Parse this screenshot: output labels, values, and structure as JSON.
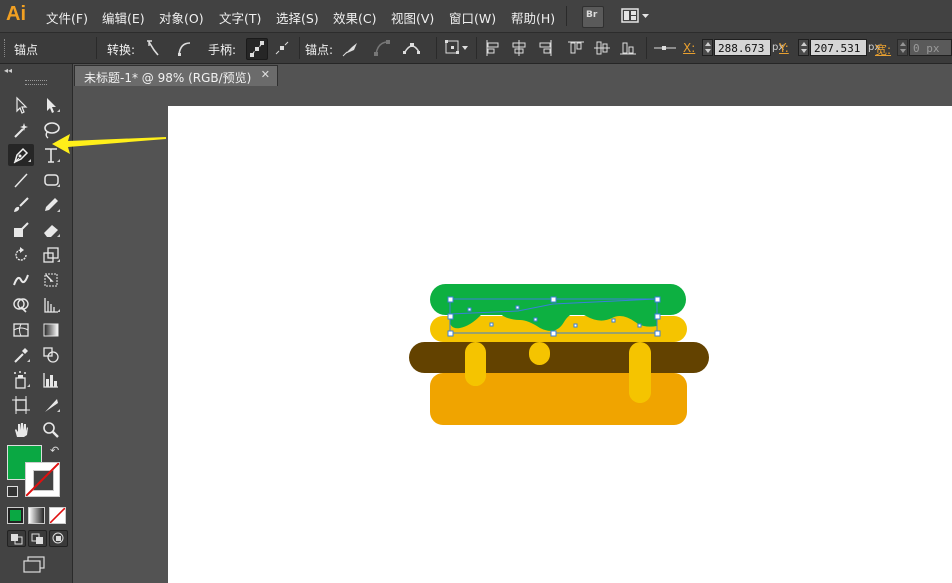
{
  "app": {
    "logo": "Ai"
  },
  "menu": [
    "文件(F)",
    "编辑(E)",
    "对象(O)",
    "文字(T)",
    "选择(S)",
    "效果(C)",
    "视图(V)",
    "窗口(W)",
    "帮助(H)"
  ],
  "menu_buttons": {
    "bridge": "Br"
  },
  "control_bar": {
    "anchor_label": "锚点",
    "convert_label": "转换:",
    "handles_label": "手柄:",
    "anchor_ops_label": "锚点:",
    "x_label": "X:",
    "x_value": "288.673",
    "x_unit": "px",
    "y_label": "Y:",
    "y_value": "207.531",
    "y_unit": "px",
    "width_label": "宽:",
    "width_value": "0 px"
  },
  "tab": {
    "title": "未标题-1* @ 98% (RGB/预览)",
    "close": "✕"
  },
  "colors": {
    "fill": "#0aa843",
    "bun_top": "#0db041",
    "cheese": "#f5c400",
    "patty": "#634200",
    "bun_bottom": "#f0a400",
    "selection": "#3a7fd9",
    "arrow": "#ffef1a"
  },
  "icons": {
    "tools": [
      "selection-tool-icon",
      "direct-selection-tool-icon",
      "magic-wand-tool-icon",
      "lasso-tool-icon",
      "pen-tool-icon",
      "type-tool-icon",
      "line-segment-tool-icon",
      "rectangle-tool-icon",
      "paintbrush-tool-icon",
      "pencil-tool-icon",
      "blob-brush-tool-icon",
      "eraser-tool-icon",
      "rotate-tool-icon",
      "scale-tool-icon",
      "warp-tool-icon",
      "free-transform-tool-icon",
      "shape-builder-tool-icon",
      "perspective-grid-tool-icon",
      "mesh-tool-icon",
      "gradient-tool-icon",
      "eyedropper-tool-icon",
      "blend-tool-icon",
      "symbol-sprayer-tool-icon",
      "column-graph-tool-icon",
      "artboard-tool-icon",
      "slice-tool-icon",
      "hand-tool-icon",
      "zoom-tool-icon"
    ]
  },
  "annotation": {
    "arrow_target": "pen-tool"
  }
}
